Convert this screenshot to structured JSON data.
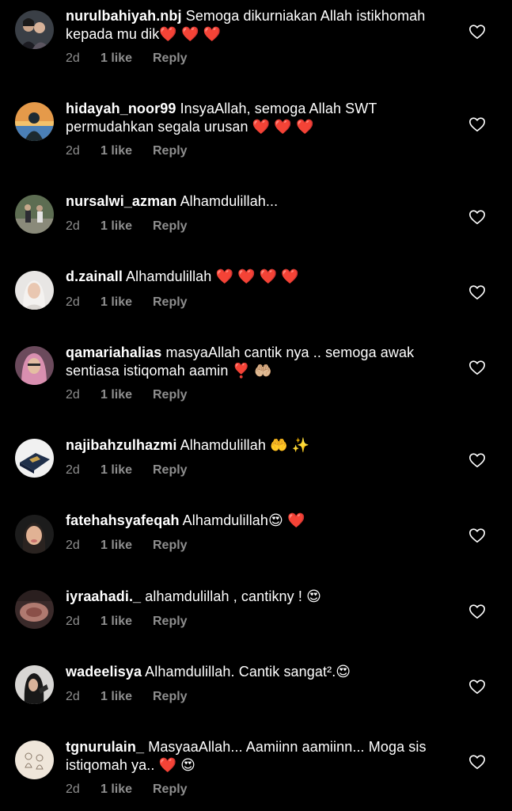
{
  "comments": [
    {
      "username": "nurulbahiyah.nbj",
      "text": "Semoga dikurniakan Allah istikhomah kepada mu dik❤️ ❤️ ❤️",
      "time": "2d",
      "likes": "1 like",
      "reply": "Reply"
    },
    {
      "username": "hidayah_noor99",
      "text": "InsyaAllah, semoga Allah SWT permudahkan segala urusan ❤️ ❤️ ❤️",
      "time": "2d",
      "likes": "1 like",
      "reply": "Reply"
    },
    {
      "username": "nursalwi_azman",
      "text": "Alhamdulillah...",
      "time": "2d",
      "likes": "1 like",
      "reply": "Reply"
    },
    {
      "username": "d.zainall",
      "text": "Alhamdulillah ❤️ ❤️ ❤️ ❤️",
      "time": "2d",
      "likes": "1 like",
      "reply": "Reply"
    },
    {
      "username": "qamariahalias",
      "text": "masyaAllah cantik nya .. semoga awak sentiasa istiqomah aamin ❣️ 🤲🏼",
      "time": "2d",
      "likes": "1 like",
      "reply": "Reply"
    },
    {
      "username": "najibahzulhazmi",
      "text": "Alhamdulillah 🤲 ✨",
      "time": "2d",
      "likes": "1 like",
      "reply": "Reply"
    },
    {
      "username": "fatehahsyafeqah",
      "text": "Alhamdulillah😍 ❤️",
      "time": "2d",
      "likes": "1 like",
      "reply": "Reply"
    },
    {
      "username": "iyraahadi._",
      "text": "alhamdulillah , cantikny ! 😍",
      "time": "2d",
      "likes": "1 like",
      "reply": "Reply"
    },
    {
      "username": "wadeelisya",
      "text": "Alhamdulillah. Cantik sangat².😍",
      "time": "2d",
      "likes": "1 like",
      "reply": "Reply"
    },
    {
      "username": "tgnurulain_",
      "text": "MasyaaAllah... Aamiinn aamiinn... Moga sis istiqomah ya.. ❤️ 😍",
      "time": "2d",
      "likes": "1 like",
      "reply": "Reply"
    }
  ],
  "icons": {
    "avatar": "avatar-photo",
    "like": "heart-outline-icon"
  },
  "colors": {
    "background": "#000000",
    "primary_text": "#ffffff",
    "secondary_text": "#8e8e8e"
  }
}
